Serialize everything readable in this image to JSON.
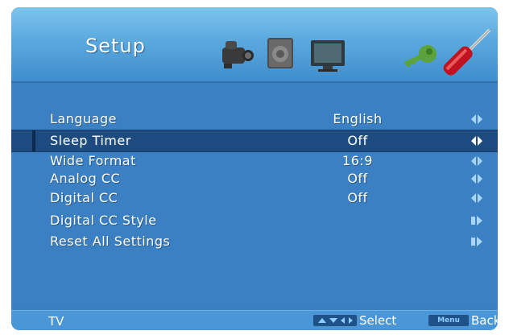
{
  "header": {
    "title": "Setup",
    "tabs": [
      {
        "name": "camera-tab-icon"
      },
      {
        "name": "speaker-tab-icon"
      },
      {
        "name": "monitor-tab-icon"
      },
      {
        "name": "key-tab-icon"
      },
      {
        "name": "screwdriver-tab-icon",
        "active": true
      }
    ]
  },
  "menu": {
    "items": [
      {
        "label": "Language",
        "value": "English",
        "arrow": "left-right",
        "selected": false
      },
      {
        "label": "Sleep Timer",
        "value": "Off",
        "arrow": "left-right",
        "selected": true
      },
      {
        "label": "Wide Format",
        "value": "16:9",
        "arrow": "left-right",
        "selected": false
      },
      {
        "label": "Analog CC",
        "value": "Off",
        "arrow": "left-right",
        "selected": false
      },
      {
        "label": "Digital CC",
        "value": "Off",
        "arrow": "left-right",
        "selected": false
      },
      {
        "label": "Digital CC Style",
        "value": "",
        "arrow": "right",
        "selected": false
      },
      {
        "label": "Reset All Settings",
        "value": "",
        "arrow": "right",
        "selected": false
      }
    ]
  },
  "footer": {
    "source": "TV",
    "select_label": "Select",
    "menu_key": "Menu",
    "back_label": "Back"
  },
  "colors": {
    "header": "#5aa9de",
    "menu_bg": "#3b80c3",
    "selected_row": "#1d4b7f",
    "footer": "#4b96d6"
  }
}
